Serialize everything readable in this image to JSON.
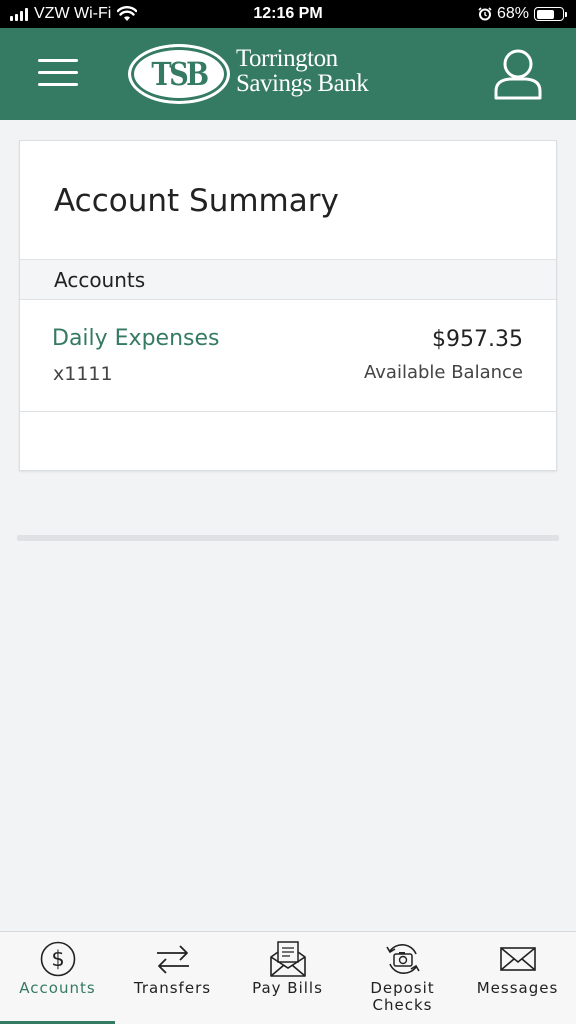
{
  "status_bar": {
    "carrier": "VZW Wi-Fi",
    "time": "12:16 PM",
    "battery_percent": "68%",
    "battery_level": 0.68,
    "icons": [
      "signal-icon",
      "wifi-icon",
      "alarm-icon",
      "battery-icon"
    ]
  },
  "header": {
    "logo_monogram": "TSB",
    "logo_line1": "Torrington",
    "logo_line2": "Savings Bank",
    "icons": [
      "menu-icon",
      "profile-icon"
    ],
    "background_color": "#357a62"
  },
  "summary": {
    "title": "Account Summary",
    "section_label": "Accounts",
    "accounts": [
      {
        "name": "Daily Expenses",
        "number": "x1111",
        "balance": "$957.35",
        "balance_label": "Available Balance"
      }
    ]
  },
  "tabs": [
    {
      "label": "Accounts",
      "icon": "dollar-circle-icon",
      "active": true
    },
    {
      "label": "Transfers",
      "icon": "transfer-arrows-icon",
      "active": false
    },
    {
      "label": "Pay Bills",
      "icon": "envelope-bill-icon",
      "active": false
    },
    {
      "label": "Deposit\nChecks",
      "icon": "camera-refresh-icon",
      "active": false
    },
    {
      "label": "Messages",
      "icon": "mail-icon",
      "active": false
    }
  ],
  "colors": {
    "brand": "#357a62",
    "accent_text": "#357a62",
    "background": "#f1f3f5"
  }
}
